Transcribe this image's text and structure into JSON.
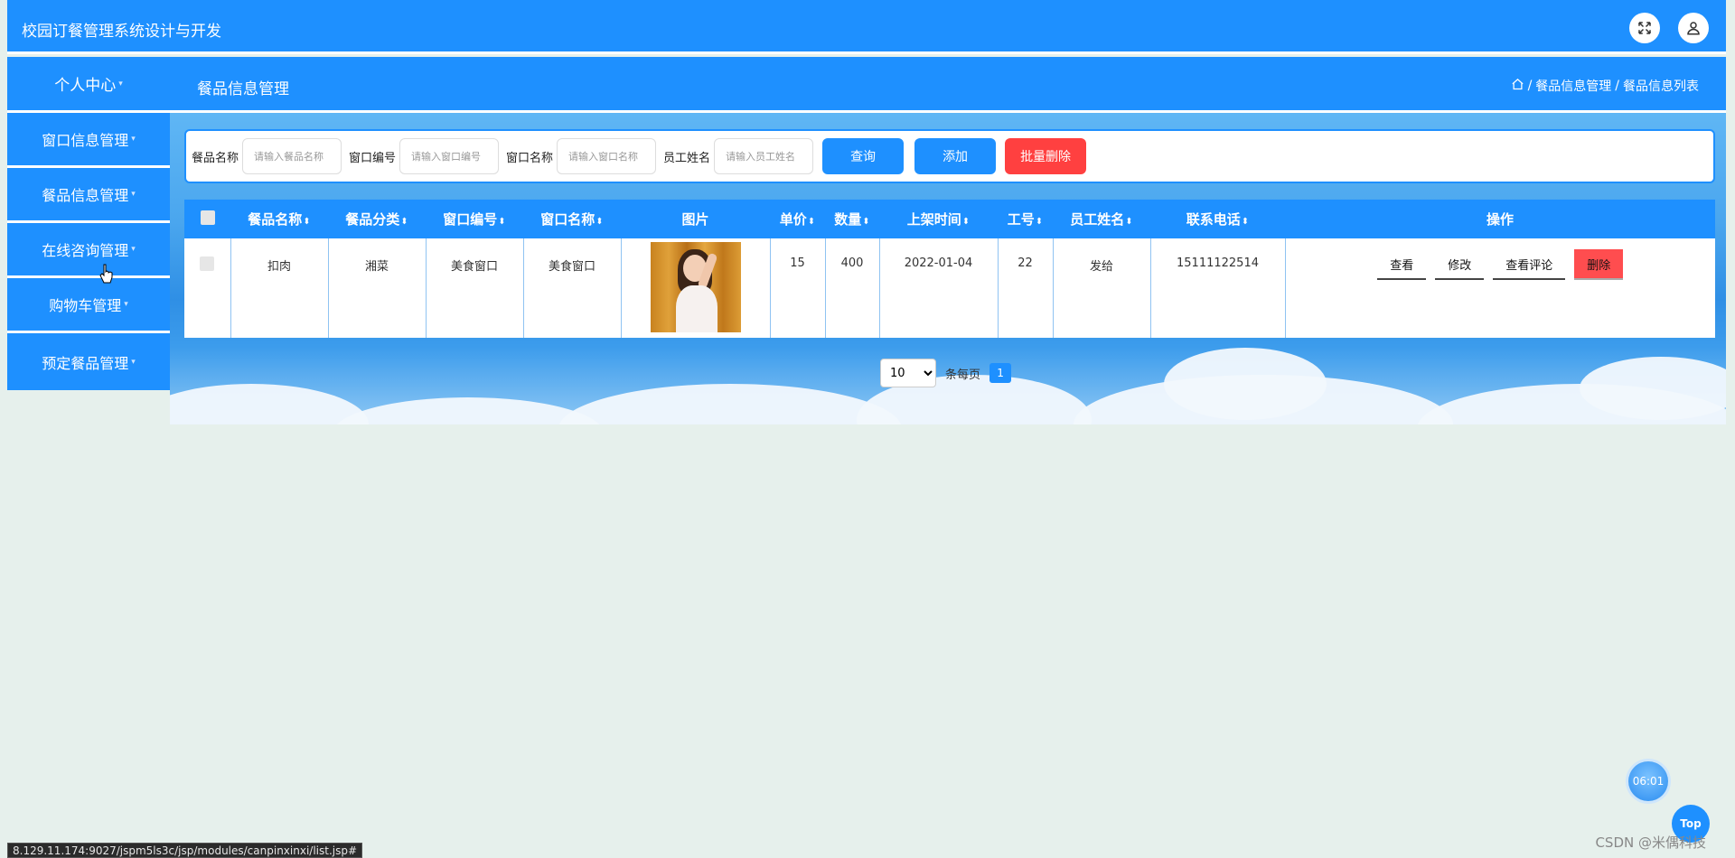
{
  "app": {
    "title": "校园订餐管理系统设计与开发",
    "colors": {
      "primary": "#1e90ff",
      "danger": "#ff4040",
      "background": "#e6f0ec"
    }
  },
  "topbar": {
    "fullscreen_icon": "fullscreen-icon",
    "user_icon": "user-icon"
  },
  "subbar": {
    "profile_label": "个人中心",
    "page_title": "餐品信息管理",
    "breadcrumb": {
      "home_icon": "home-icon",
      "sep1": "/",
      "level1": "餐品信息管理",
      "sep2": "/",
      "level2": "餐品信息列表"
    }
  },
  "sidebar": {
    "items": [
      {
        "label": "窗口信息管理"
      },
      {
        "label": "餐品信息管理"
      },
      {
        "label": "在线咨询管理"
      },
      {
        "label": "购物车管理"
      },
      {
        "label": "预定餐品管理"
      }
    ]
  },
  "search": {
    "fields": [
      {
        "label": "餐品名称",
        "placeholder": "请输入餐品名称"
      },
      {
        "label": "窗口编号",
        "placeholder": "请输入窗口编号"
      },
      {
        "label": "窗口名称",
        "placeholder": "请输入窗口名称"
      },
      {
        "label": "员工姓名",
        "placeholder": "请输入员工姓名"
      }
    ],
    "query_label": "查询",
    "add_label": "添加",
    "batch_delete_label": "批量删除"
  },
  "table": {
    "columns": [
      "餐品名称",
      "餐品分类",
      "窗口编号",
      "窗口名称",
      "图片",
      "单价",
      "数量",
      "上架时间",
      "工号",
      "员工姓名",
      "联系电话",
      "操作"
    ],
    "sort_glyph": "⬍",
    "rows": [
      {
        "name": "扣肉",
        "category": "湘菜",
        "window_no": "美食窗口",
        "window_name": "美食窗口",
        "price": "15",
        "quantity": "400",
        "listed_time": "2022-01-04",
        "emp_no": "22",
        "emp_name": "发给",
        "phone": "15111122514",
        "actions": {
          "view": "查看",
          "edit": "修改",
          "comments": "查看评论",
          "delete": "删除"
        }
      }
    ]
  },
  "pagination": {
    "page_size": "10",
    "page_size_options": [
      "10"
    ],
    "per_page_label": "条每页",
    "current_page": "1"
  },
  "floating": {
    "timer": "06:01",
    "top_label": "Top",
    "watermark": "CSDN @米偶科技"
  },
  "status_url": "8.129.11.174:9027/jspm5ls3c/jsp/modules/canpinxinxi/list.jsp#"
}
